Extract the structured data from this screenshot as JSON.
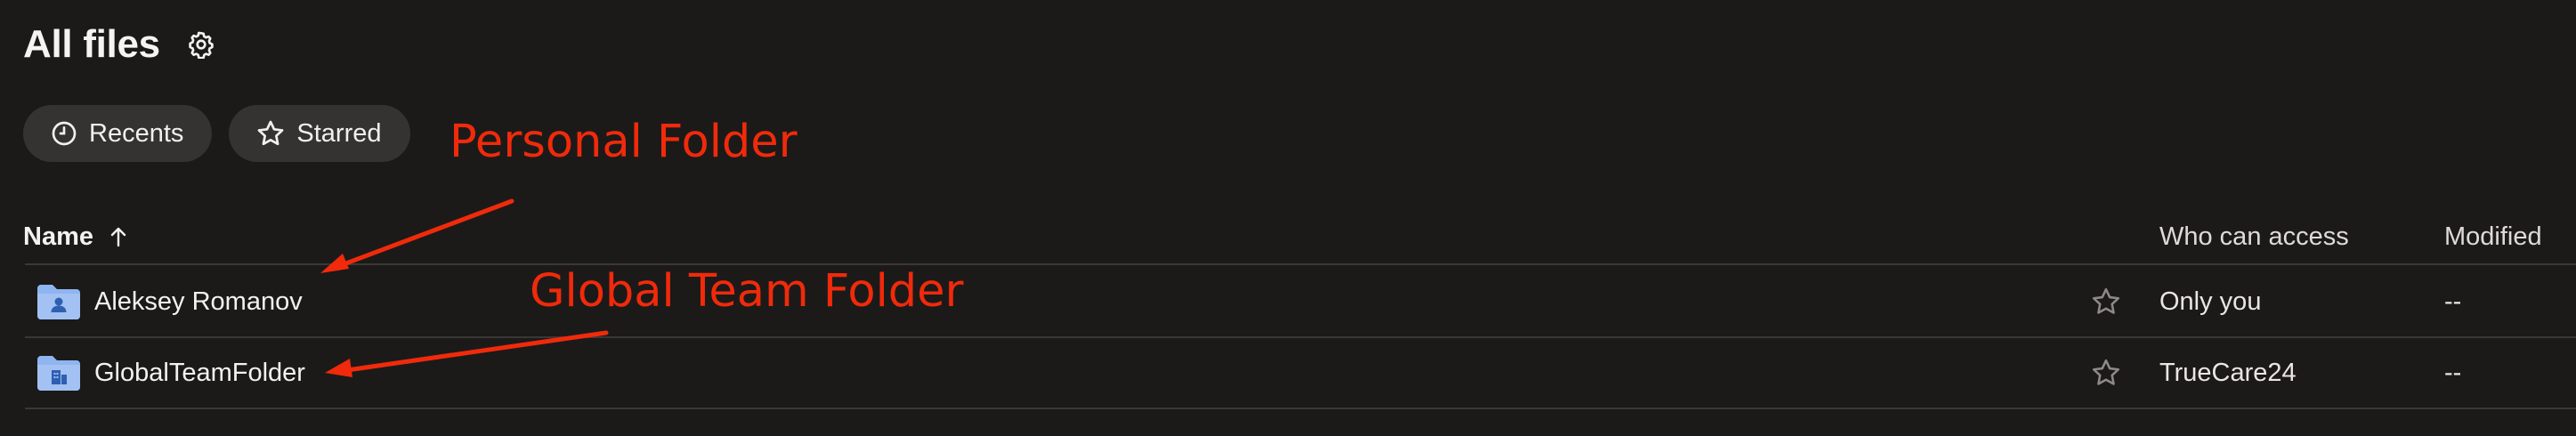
{
  "header": {
    "title": "All files",
    "settings_icon": "gear-icon"
  },
  "filters": [
    {
      "label": "Recents",
      "icon": "clock-icon"
    },
    {
      "label": "Starred",
      "icon": "star-icon"
    }
  ],
  "table": {
    "columns": {
      "name": "Name",
      "sort_icon": "arrow-up-icon",
      "who_can_access": "Who can access",
      "modified": "Modified"
    },
    "rows": [
      {
        "name": "Aleksey Romanov",
        "icon": "personal-folder-icon",
        "access": "Only you",
        "modified": "--"
      },
      {
        "name": "GlobalTeamFolder",
        "icon": "team-folder-icon",
        "access": "TrueCare24",
        "modified": "--"
      }
    ]
  },
  "annotations": {
    "personal": "Personal Folder",
    "team": "Global Team Folder",
    "color": "#f02a0b"
  },
  "colors": {
    "background": "#1b1a19",
    "chip": "#353331",
    "folder": "#8fb5f0",
    "divider": "#3a3836"
  }
}
